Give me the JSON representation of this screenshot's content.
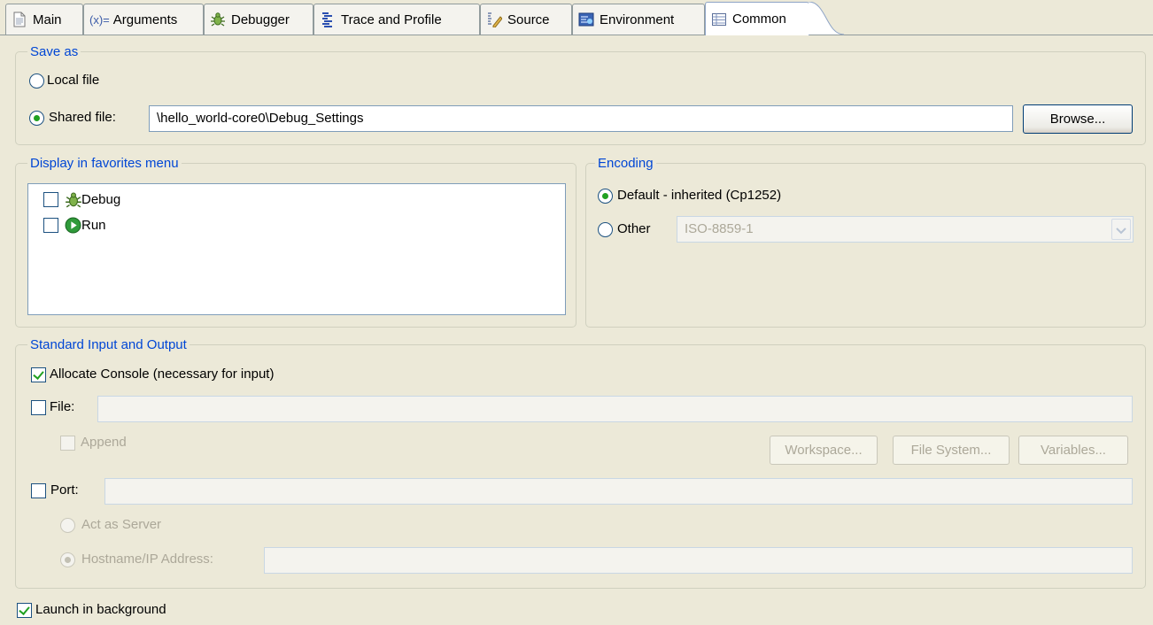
{
  "tabs": [
    {
      "label": "Main",
      "icon": "document-icon"
    },
    {
      "label": "Arguments",
      "icon": "variable-icon",
      "prefix": "(x)="
    },
    {
      "label": "Debugger",
      "icon": "bug-icon"
    },
    {
      "label": "Trace and Profile",
      "icon": "trace-icon"
    },
    {
      "label": "Source",
      "icon": "source-icon"
    },
    {
      "label": "Environment",
      "icon": "environment-icon"
    },
    {
      "label": "Common",
      "icon": "table-icon",
      "active": true
    }
  ],
  "save_as": {
    "legend": "Save as",
    "local_file_label": "Local file",
    "shared_file_label": "Shared file:",
    "shared_file_value": "\\hello_world-core0\\Debug_Settings",
    "browse_label": "Browse...",
    "selected": "shared"
  },
  "favorites": {
    "legend": "Display in favorites menu",
    "items": [
      {
        "label": "Debug",
        "icon": "bug-icon",
        "checked": false
      },
      {
        "label": "Run",
        "icon": "run-icon",
        "checked": false
      }
    ]
  },
  "encoding": {
    "legend": "Encoding",
    "default_label": "Default - inherited (Cp1252)",
    "other_label": "Other",
    "other_value": "ISO-8859-1",
    "selected": "default"
  },
  "stdio": {
    "legend": "Standard Input and Output",
    "allocate_console_label": "Allocate Console (necessary for input)",
    "allocate_console_checked": true,
    "file_label": "File:",
    "file_checked": false,
    "append_label": "Append",
    "workspace_label": "Workspace...",
    "file_system_label": "File System...",
    "variables_label": "Variables...",
    "port_label": "Port:",
    "port_checked": false,
    "act_as_server_label": "Act as Server",
    "hostname_label": "Hostname/IP Address:"
  },
  "launch_background": {
    "label": "Launch in background",
    "checked": true
  },
  "colors": {
    "legend": "#0046d5",
    "check": "#21a121",
    "background": "#ece9d8"
  }
}
